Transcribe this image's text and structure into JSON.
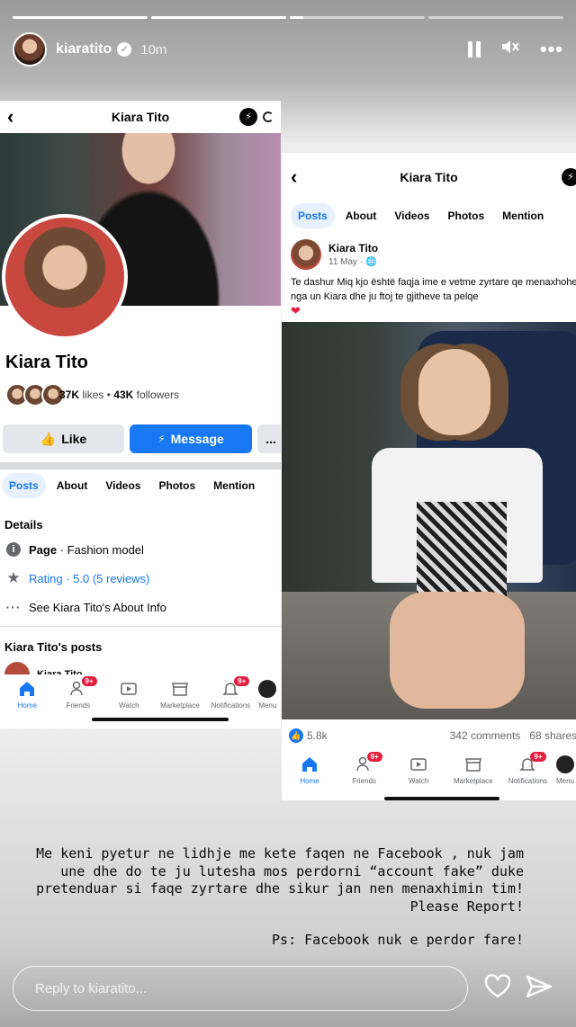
{
  "story": {
    "username": "kiaratito",
    "time": "10m"
  },
  "left_page": {
    "title": "Kiara Tito",
    "page_name": "Kiara Tito",
    "likes_count": "37K",
    "likes_label": "likes",
    "separator": "•",
    "followers_count": "43K",
    "followers_label": "followers",
    "like_button": "Like",
    "message_button": "Message",
    "more_button": "...",
    "tabs": [
      "Posts",
      "About",
      "Videos",
      "Photos",
      "Mention"
    ],
    "details_heading": "Details",
    "page_label": "Page",
    "page_category": "· Fashion model",
    "rating_text": "Rating · 5.0 (5 reviews)",
    "about_info": "See Kiara Tito's About Info",
    "posts_heading": "Kiara Tito's posts",
    "peek_name": "Kiara Tito"
  },
  "nav": {
    "items": [
      "Home",
      "Friends",
      "Watch",
      "Marketplace",
      "Notifications",
      "Menu"
    ],
    "friends_badge": "9+",
    "notifications_badge": "9+"
  },
  "right_page": {
    "title": "Kiara Tito",
    "tabs": [
      "Posts",
      "About",
      "Videos",
      "Photos",
      "Mention"
    ],
    "post_author": "Kiara Tito",
    "post_date": "11 May · ",
    "post_text": "Te dashur Miq kjo është faqja ime e vetme zyrtare qe menaxhohet  nga un Kiara  dhe ju ftoj te gjitheve ta pelqe",
    "reaction_count": "5.8k",
    "comments": "342 comments",
    "shares": "68 shares"
  },
  "caption": {
    "line1": "Me keni pyetur ne lidhje me kete faqen ne Facebook , nuk jam",
    "line2": "une dhe do te ju lutesha mos perdorni “account fake” duke",
    "line3": "pretenduar si faqe zyrtare dhe sikur jan nen menaxhimin tim!",
    "line4": "Please Report!",
    "ps": "Ps: Facebook nuk e perdor fare!"
  },
  "reply": {
    "placeholder": "Reply to kiaratito..."
  },
  "colors": {
    "facebook_blue": "#1877f2",
    "badge_red": "#e41e3f"
  },
  "icons": [
    "pause-icon",
    "mute-icon",
    "more-icon",
    "back-icon",
    "messenger-icon",
    "like-thumb-icon",
    "messenger-bolt-icon",
    "info-icon",
    "star-icon",
    "dots-icon",
    "home-icon",
    "friends-icon",
    "watch-icon",
    "marketplace-icon",
    "notifications-icon",
    "menu-avatar-icon",
    "globe-icon",
    "heart-icon",
    "send-icon"
  ]
}
